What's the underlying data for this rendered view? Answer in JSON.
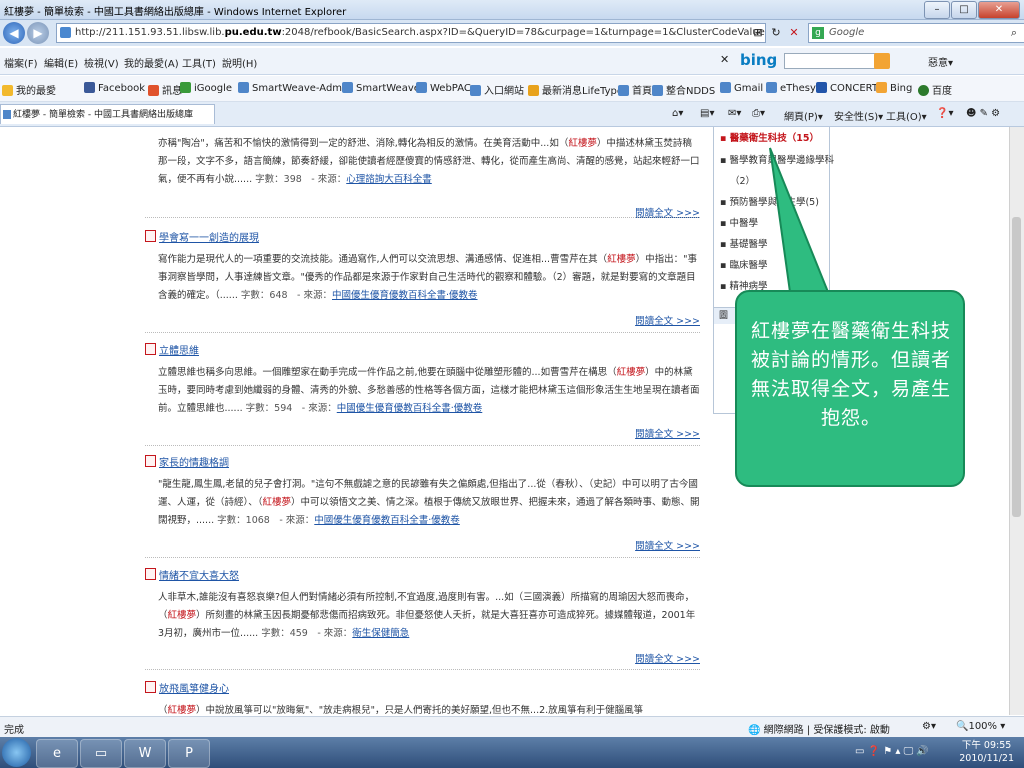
{
  "window": {
    "title": "紅樓夢 - 簡單檢索 - 中國工具書網絡出版總庫 - Windows Internet Explorer"
  },
  "address": {
    "url_prefix": "http://211.151.93.51.libsw.lib.",
    "url_domain": "pu.edu.tw",
    "url_rest": ":2048/refbook/BasicSearch.aspx?ID=&QueryID=78&curpage=1&turnpage=1&ClusterCodeValue=E&systemno=&naviDataba"
  },
  "search": {
    "placeholder": "Google"
  },
  "menu": {
    "items": [
      "檔案(F)",
      "編輯(E)",
      "檢視(V)",
      "我的最愛(A)",
      "工具(T)",
      "說明(H)"
    ]
  },
  "bing": {
    "logo": "bing",
    "right": "惡意▾"
  },
  "favorites": {
    "items": [
      "我的最愛",
      "Facebook",
      "訊息",
      "iGoogle",
      "SmartWeave-Admin",
      "SmartWeaver",
      "WebPAC",
      "入口網站",
      "最新消息LifeType",
      "首頁",
      "整合NDDS",
      "Gmail",
      "eThesys",
      "CONCERT",
      "Bing",
      "百度"
    ]
  },
  "tab": {
    "label": "紅樓夢 - 簡單檢索 - 中國工具書網絡出版總庫"
  },
  "commandbar": {
    "page": "網頁(P)▾",
    "safety": "安全性(S)▾",
    "tools": "工具(O)▾"
  },
  "results": [
    {
      "title": "",
      "pre": "亦稱\"陶冶\"，痛苦和不愉快的激情得到一定的舒泄、消除,轉化為相反的激情。在美育活動中...如（",
      "hl": "紅樓夢",
      "post": "）中描述林黛玉焚詩稿那一段，文字不多，語言簡練，節奏舒緩，卻能使讀者經歷傻寶的情感舒泄、轉化，從而產生高尚、清醒的感覺，站起來輕舒一口氣，便不再有小說......",
      "meta": "字數：398　- 來源：",
      "source": "心理諮詢大百科全書",
      "readmore": "閱讀全文 >>>"
    },
    {
      "title": "學會寫一一創造的展現",
      "pre": "寫作能力是現代人的一項重要的交流技能。通過寫作,人們可以交流思想、溝通感情、促進相...曹雪芹在其（",
      "hl": "紅樓夢",
      "post": "）中指出：\"事事洞察皆學問，人事達練皆文章。\"優秀的作品都是來源于作家對自己生活時代的觀察和體驗。（2）審題，就是對要寫的文章題目含義的確定。（......",
      "meta": "字數：648　- 來源：",
      "source": "中國優生優育優教百科全書·優教卷",
      "readmore": "閱讀全文 >>>"
    },
    {
      "title": "立體思維",
      "pre": "立體思維也稱多向思維。一個雕塑家在動手完成一件作品之前,他要在頭腦中從雕塑形體的...如曹雪芹在構思（",
      "hl": "紅樓夢",
      "post": "）中的林黛玉時，要同時考慮到她纖弱的身體、清秀的外貌、多愁善感的性格等各個方面，這樣才能把林黛玉這個形象活生生地呈現在讀者面前。立體思維也......",
      "meta": "字數：594　- 來源：",
      "source": "中國優生優育優教百科全書·優教卷",
      "readmore": "閱讀全文 >>>"
    },
    {
      "title": "家長的情趣格調",
      "pre": "\"龍生龍,鳳生鳳,老鼠的兒子會打洞。\"這句不無戲謔之意的民諺雖有失之偏頗處,但指出了...從（春秋）、（史記）中可以明了古今國運、人運，從（詩經）、（",
      "hl": "紅樓夢",
      "post": "）中可以領悟文之美、情之深。植根于傳統又放眼世界、把握未來，通過了解各類時事、動態、開闊視野，......",
      "meta": "字數：1068　- 來源：",
      "source": "中國優生優育優教百科全書·優教卷",
      "readmore": "閱讀全文 >>>"
    },
    {
      "title": "情緒不宜大喜大怒",
      "pre": "人非草木,誰能沒有喜怒哀樂?但人們對情緒必須有所控制,不宜過度,過度則有害。...如（三國演義）所描寫的周瑜因大怒而喪命，（",
      "hl": "紅樓夢",
      "post": "）所刻畫的林黛玉因長期憂郁悲傷而招病致死。非但憂怒使人夭折，就是大喜狂喜亦可造成猝死。據媒體報道，2001年3月初，廣州市一位......",
      "meta": "字數：459　- 來源：",
      "source": "衛生保健簡急",
      "readmore": "閱讀全文 >>>"
    },
    {
      "title": "放飛風箏健身心",
      "pre": "（",
      "hl": "紅樓夢",
      "post": "）中說放風箏可以\"放晦氣\"、\"放走病根兒\"，只是人們寄托的美好願望,但也不無...2.放風箏有利于健腦風箏",
      "meta": "",
      "source": "",
      "readmore": ""
    }
  ],
  "sidebar": {
    "items": [
      "▪ 醫藥衛生科技（15）",
      "▪ 醫學教育與醫學邊緣學科",
      "（2）",
      "▪ 預防醫學與衛生學(5)",
      "▪ 中醫學",
      "▪ 基礎醫學",
      "▪ 臨床醫學",
      "▪ 精神病學"
    ],
    "box_label": "圖"
  },
  "callout": {
    "text": "紅樓夢在醫藥衛生科技被討論的情形。但讀者無法取得全文，易產生抱怨。"
  },
  "status": {
    "left": "完成",
    "zone": "網際網路 | 受保護模式: 啟動",
    "zoom": "100%"
  },
  "clock": {
    "time": "下午 09:55",
    "date": "2010/11/21"
  }
}
